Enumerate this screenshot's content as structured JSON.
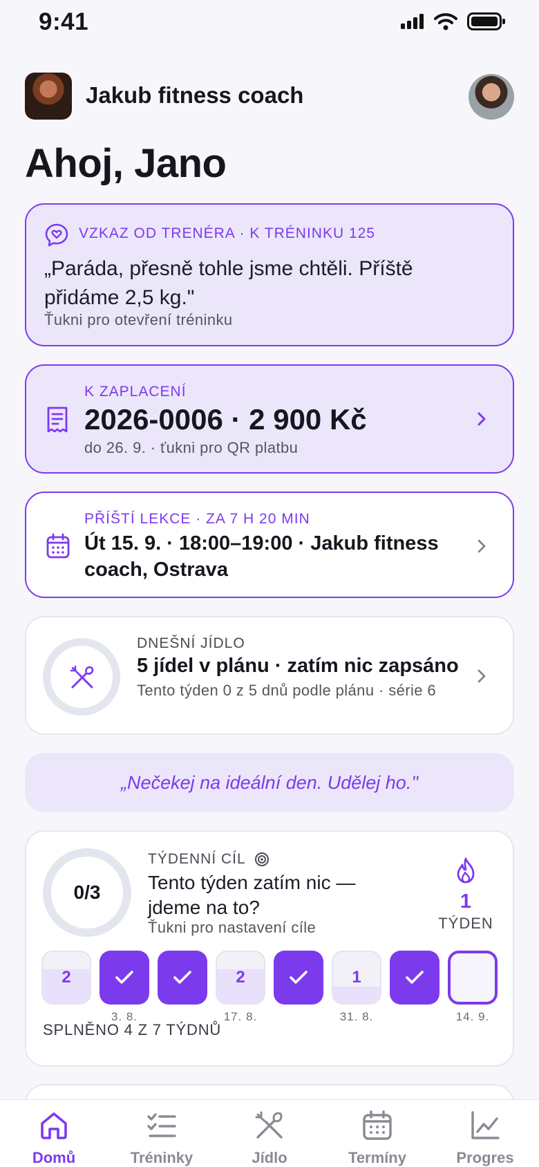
{
  "status_bar": {
    "time": "9:41"
  },
  "header": {
    "coach_name": "Jakub fitness coach"
  },
  "greeting": "Ahoj, Jano",
  "message_card": {
    "eyebrow": "VZKAZ OD TRENÉRA · K TRÉNINKU 125",
    "quote": "„Paráda, přesně tohle jsme chtěli. Příště přidáme 2,5 kg.\"",
    "hint": "Ťukni pro otevření tréninku"
  },
  "payment_card": {
    "eyebrow": "K ZAPLACENÍ",
    "amount": "2026-0006 · 2 900 Kč",
    "hint": "do 26. 9. · ťukni pro QR platbu"
  },
  "lesson_card": {
    "eyebrow": "PŘÍŠTÍ LEKCE · ZA 7 H 20 MIN",
    "title": "Út 15. 9. · 18:00–19:00 · Jakub fitness coach, Ostrava"
  },
  "food_card": {
    "eyebrow": "DNEŠNÍ JÍDLO",
    "title": "5 jídel v plánu · zatím nic zapsáno",
    "hint": "Tento týden 0 z 5 dnů podle plánu · série 6"
  },
  "motto": "„Nečekej na ideální den. Udělej ho.\"",
  "goal_card": {
    "ring_value": "0/3",
    "eyebrow": "TÝDENNÍ CÍL",
    "title": "Tento týden zatím nic — jdeme na to?",
    "hint": "Ťukni pro nastavení cíle",
    "streak_value": "1",
    "streak_label": "TÝDEN",
    "weeks": [
      {
        "state": "partial",
        "count": "2",
        "fill_fraction": 0.66
      },
      {
        "state": "done"
      },
      {
        "state": "done"
      },
      {
        "state": "partial",
        "count": "2",
        "fill_fraction": 0.66
      },
      {
        "state": "done"
      },
      {
        "state": "partial",
        "count": "1",
        "fill_fraction": 0.33
      },
      {
        "state": "done"
      },
      {
        "state": "current"
      }
    ],
    "date_labels": [
      "",
      "3. 8.",
      "",
      "17. 8.",
      "",
      "31. 8.",
      "",
      "14. 9."
    ],
    "summary": "SPLNĚNO 4 Z 7 TÝDNŮ"
  },
  "tabs": [
    {
      "label": "Domů",
      "icon": "home-icon",
      "active": true
    },
    {
      "label": "Tréninky",
      "icon": "checklist-icon",
      "active": false
    },
    {
      "label": "Jídlo",
      "icon": "fork-knife-icon",
      "active": false
    },
    {
      "label": "Termíny",
      "icon": "calendar-icon",
      "active": false
    },
    {
      "label": "Progres",
      "icon": "chart-icon",
      "active": false
    }
  ],
  "colors": {
    "accent": "#7c3aed",
    "accent_light": "#ece6fb",
    "background": "#f7f7fb"
  }
}
